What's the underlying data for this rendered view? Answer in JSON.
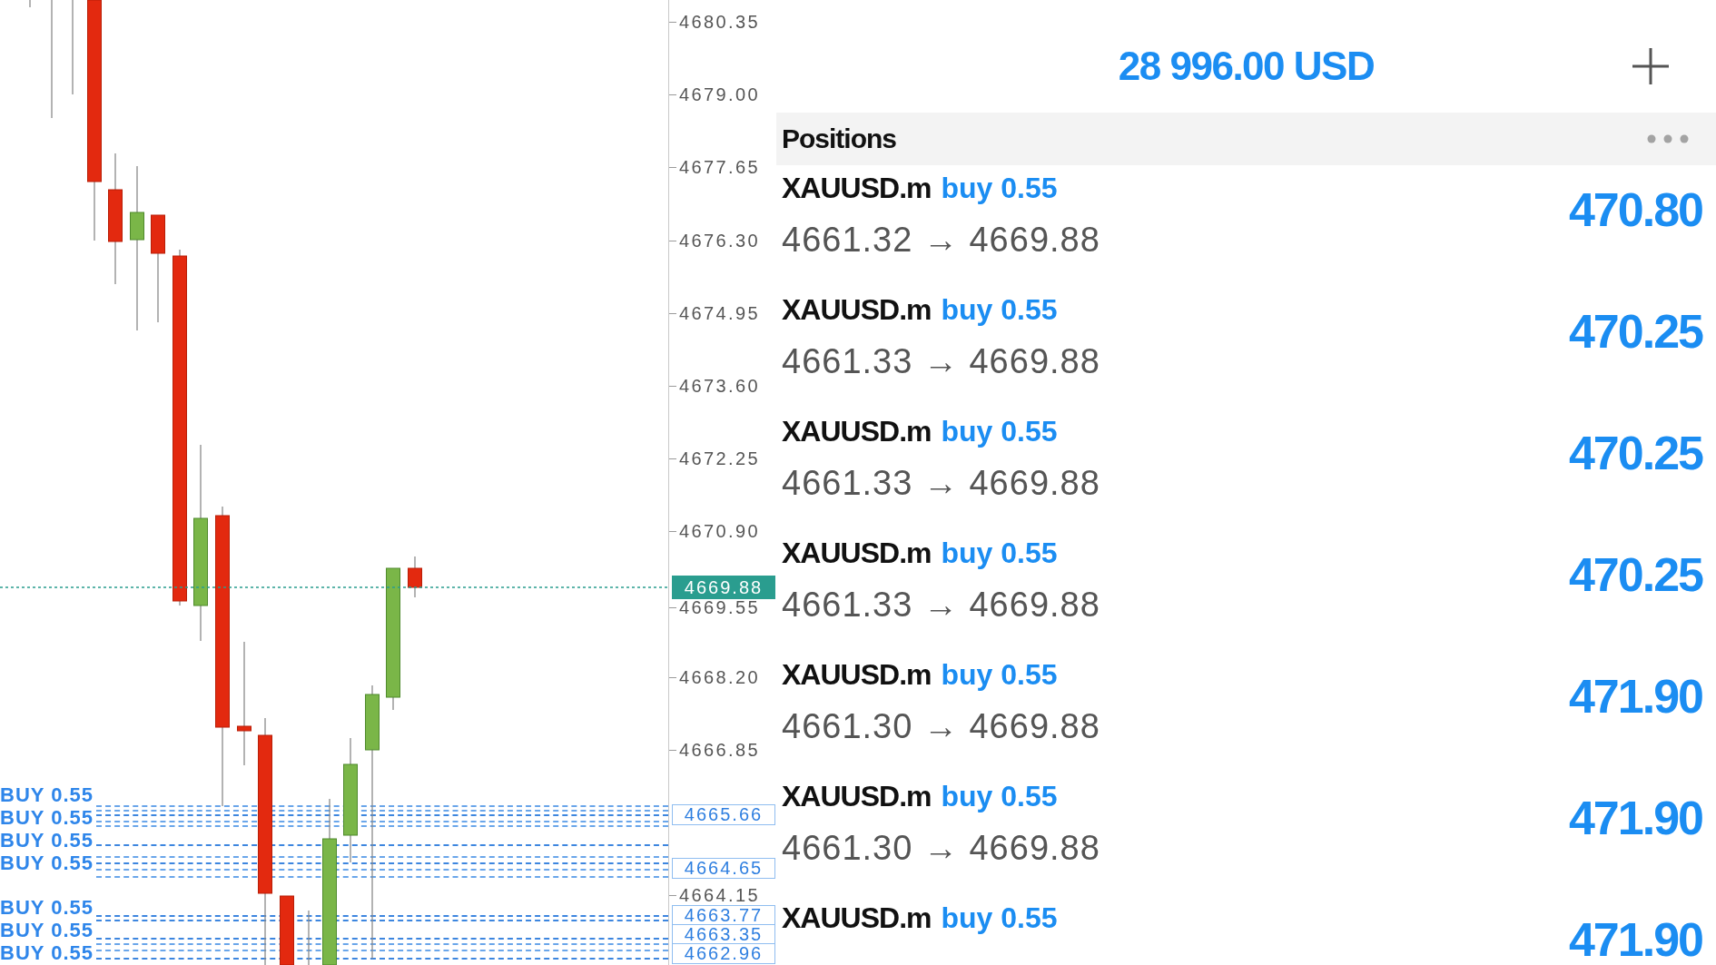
{
  "chart": {
    "order_labels": [
      "BUY 0.55",
      "BUY 0.55",
      "BUY 0.55",
      "BUY 0.55",
      "BUY 0.55",
      "BUY 0.55",
      "BUY 0.55"
    ],
    "price_ticks": [
      "4680.35",
      "4679.00",
      "4677.65",
      "4676.30",
      "4674.95",
      "4673.60",
      "4672.25",
      "4670.90",
      "4669.55",
      "4668.20",
      "4666.85",
      "4664.15"
    ],
    "current_price": "4669.88",
    "order_prices": [
      "4665.66",
      "4664.65",
      "4663.77",
      "4663.35",
      "4662.96"
    ]
  },
  "account": {
    "balance": "28 996.00 USD"
  },
  "positions": {
    "title": "Positions",
    "rows": [
      {
        "symbol": "XAUUSD.m",
        "order": "buy 0.55",
        "prices": "4661.32 → 4669.88",
        "profit": "470.80"
      },
      {
        "symbol": "XAUUSD.m",
        "order": "buy 0.55",
        "prices": "4661.33 → 4669.88",
        "profit": "470.25"
      },
      {
        "symbol": "XAUUSD.m",
        "order": "buy 0.55",
        "prices": "4661.33 → 4669.88",
        "profit": "470.25"
      },
      {
        "symbol": "XAUUSD.m",
        "order": "buy 0.55",
        "prices": "4661.33 → 4669.88",
        "profit": "470.25"
      },
      {
        "symbol": "XAUUSD.m",
        "order": "buy 0.55",
        "prices": "4661.30 → 4669.88",
        "profit": "471.90"
      },
      {
        "symbol": "XAUUSD.m",
        "order": "buy 0.55",
        "prices": "4661.30 → 4669.88",
        "profit": "471.90"
      },
      {
        "symbol": "XAUUSD.m",
        "order": "buy 0.55",
        "profit": "471.90"
      }
    ]
  }
}
